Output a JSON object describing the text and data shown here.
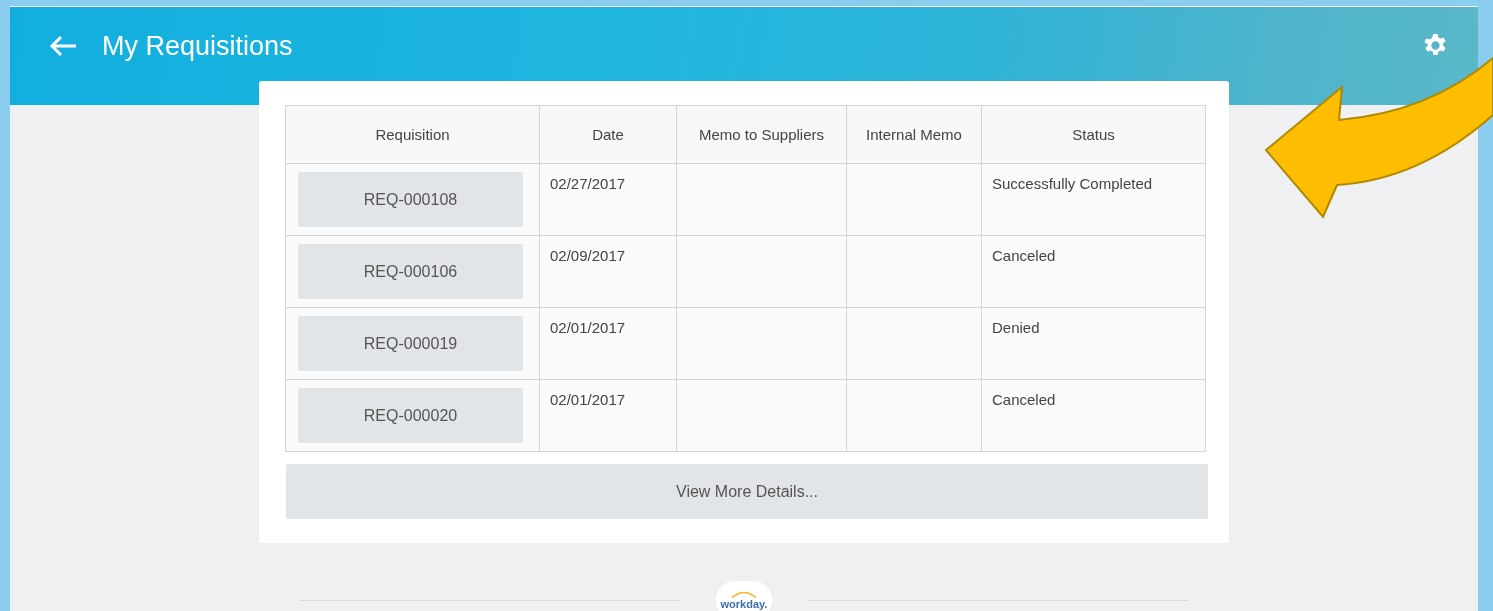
{
  "header": {
    "title": "My Requisitions"
  },
  "table": {
    "columns": [
      "Requisition",
      "Date",
      "Memo to Suppliers",
      "Internal Memo",
      "Status"
    ],
    "rows": [
      {
        "requisition": "REQ-000108",
        "date": "02/27/2017",
        "status": "Successfully Completed"
      },
      {
        "requisition": "REQ-000106",
        "date": "02/09/2017",
        "status": "Canceled"
      },
      {
        "requisition": "REQ-000019",
        "date": "02/01/2017",
        "status": "Denied"
      },
      {
        "requisition": "REQ-000020",
        "date": "02/01/2017",
        "status": "Canceled"
      }
    ]
  },
  "more_button": "View More Details...",
  "footer": {
    "logo": "workday."
  }
}
